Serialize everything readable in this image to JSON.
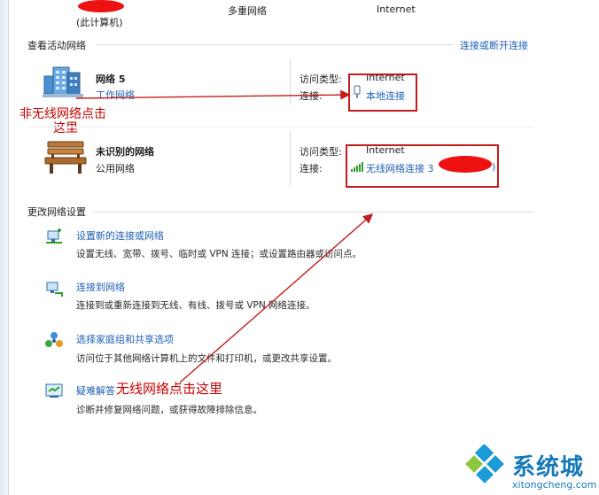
{
  "topmap": {
    "computer_sublabel": "(此计算机)",
    "multi_network": "多重网络",
    "internet": "Internet"
  },
  "active_section": {
    "title": "查看活动网络",
    "connect_disconnect_link": "连接或断开连接"
  },
  "networks": [
    {
      "name": "网络  5",
      "type": "工作网络",
      "access_label": "访问类型:",
      "access_value": "Internet",
      "conn_label": "连接:",
      "conn_value": "本地连接",
      "icon": "building-network-icon"
    },
    {
      "name": "未识别的网络",
      "type": "公用网络",
      "access_label": "访问类型:",
      "access_value": "Internet",
      "conn_label": "连接:",
      "conn_value": "无线网络连接 3",
      "conn_suffix": ")",
      "icon": "park-bench-icon"
    }
  ],
  "change_section": {
    "title": "更改网络设置",
    "tasks": [
      {
        "title": "设置新的连接或网络",
        "desc": "设置无线、宽带、拨号、临时或 VPN 连接；或设置路由器或访问点。",
        "icon": "new-connection-icon"
      },
      {
        "title": "连接到网络",
        "desc": "连接到或重新连接到无线、有线、拨号或 VPN 网络连接。",
        "icon": "connect-network-icon"
      },
      {
        "title": "选择家庭组和共享选项",
        "desc": "访问位于其他网络计算机上的文件和打印机，或更改共享设置。",
        "icon": "homegroup-icon"
      },
      {
        "title": "疑难解答",
        "desc": "诊断并修复网络问题，或获得故障排除信息。",
        "icon": "troubleshoot-icon"
      }
    ]
  },
  "annotations": {
    "non_wireless_line1": "非无线网络点击",
    "non_wireless_line2": "这里",
    "wireless": "无线网络点击这里",
    "color": "#c21d1d"
  },
  "watermark": {
    "brand": "系统城",
    "url": "xitongcheng.com",
    "logo_color": "#1a9ad6"
  }
}
